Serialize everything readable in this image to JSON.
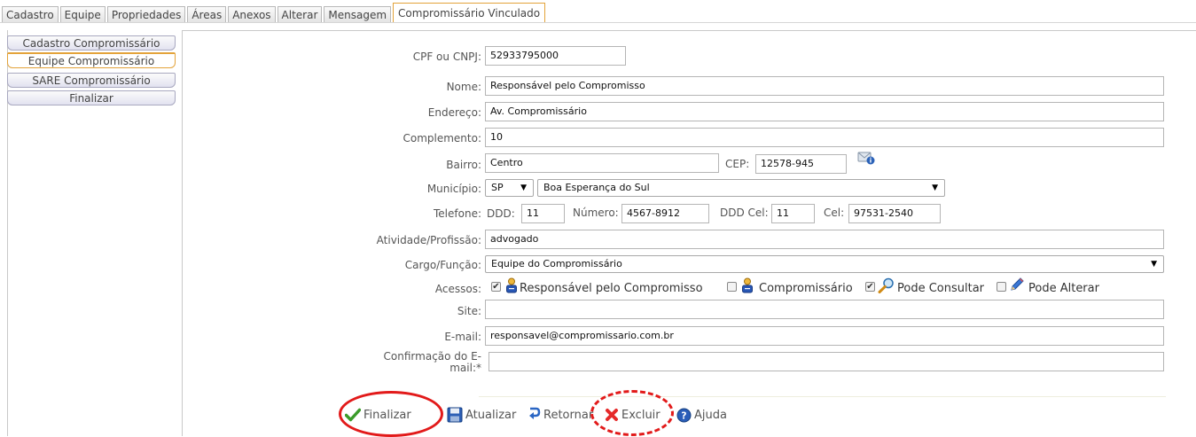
{
  "top_tabs": [
    "Cadastro",
    "Equipe",
    "Propriedades",
    "Áreas",
    "Anexos",
    "Alterar",
    "Mensagem",
    "Compromissário Vinculado"
  ],
  "side_tabs": [
    "Cadastro Compromissário",
    "Equipe Compromissário",
    "SARE Compromissário",
    "Finalizar"
  ],
  "form": {
    "cpf_label": "CPF ou CNPJ:",
    "cpf_value": "52933795000",
    "nome_label": "Nome:",
    "nome_value": "Responsável pelo Compromisso",
    "endereco_label": "Endereço:",
    "endereco_value": "Av. Compromissário",
    "complemento_label": "Complemento:",
    "complemento_value": "10",
    "bairro_label": "Bairro:",
    "bairro_value": "Centro",
    "cep_label": "CEP:",
    "cep_value": "12578-945",
    "municipio_label": "Município:",
    "uf_value": "SP",
    "cidade_value": "Boa Esperança do Sul",
    "telefone_label": "Telefone:",
    "ddd_label": "DDD:",
    "ddd_value": "11",
    "numero_label": "Número:",
    "numero_value": "4567-8912",
    "ddd_cel_label": "DDD Cel:",
    "ddd_cel_value": "11",
    "cel_label": "Cel:",
    "cel_value": "97531-2540",
    "atividade_label": "Atividade/Profissão:",
    "atividade_value": "advogado",
    "cargo_label": "Cargo/Função:",
    "cargo_value": "Equipe do Compromissário",
    "acessos_label": "Acessos:",
    "acesso_responsavel": "Responsável pelo Compromisso",
    "acesso_compromissario": "Compromissário",
    "acesso_consultar": "Pode Consultar",
    "acesso_alterar": "Pode Alterar",
    "site_label": "Site:",
    "site_value": "",
    "email_label": "E-mail:",
    "email_value": "responsavel@compromissario.com.br",
    "confirmacao_label_1": "Confirmação do E-",
    "confirmacao_label_2": "mail:*",
    "confirmacao_value": ""
  },
  "toolbar": {
    "finalizar": "Finalizar",
    "atualizar": "Atualizar",
    "retornar": "Retornar",
    "excluir": "Excluir",
    "ajuda": "Ajuda"
  },
  "colors": {
    "active_tab_border": "#e3a33a",
    "annotation_red": "#e21a1a",
    "check_green": "#3a9b2a",
    "delete_red": "#e52a2a",
    "help_blue": "#2a5db8"
  }
}
